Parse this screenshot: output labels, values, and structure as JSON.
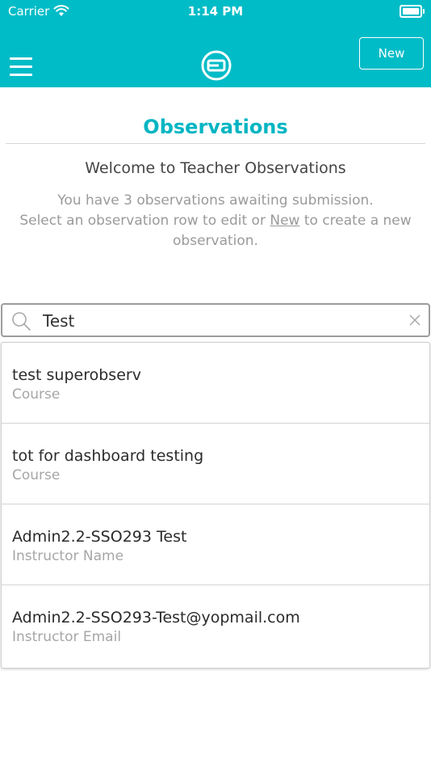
{
  "status_bar": {
    "carrier": "Carrier",
    "time": "1:14 PM"
  },
  "header": {
    "new_label": "New",
    "menu_icon": "hamburger-menu-icon",
    "logo_icon": "app-logo-icon"
  },
  "page": {
    "title": "Observations",
    "welcome": "Welcome to Teacher Observations",
    "info_line1": "You have 3 observations awaiting submission.",
    "info_line2_pre": "Select an observation row to edit or ",
    "info_link": "New",
    "info_line2_post": " to create a new observation."
  },
  "search": {
    "value": "Test",
    "placeholder": "Search"
  },
  "results": [
    {
      "title": "test superobserv",
      "subtitle": "Course"
    },
    {
      "title": "tot for dashboard testing",
      "subtitle": "Course"
    },
    {
      "title": "Admin2.2-SSO293 Test",
      "subtitle": "Instructor Name"
    },
    {
      "title": "Admin2.2-SSO293-Test@yopmail.com",
      "subtitle": "Instructor Email"
    }
  ],
  "colors": {
    "accent": "#00bcc7",
    "title": "#00b5c3",
    "muted_text": "#9a9a9a"
  }
}
